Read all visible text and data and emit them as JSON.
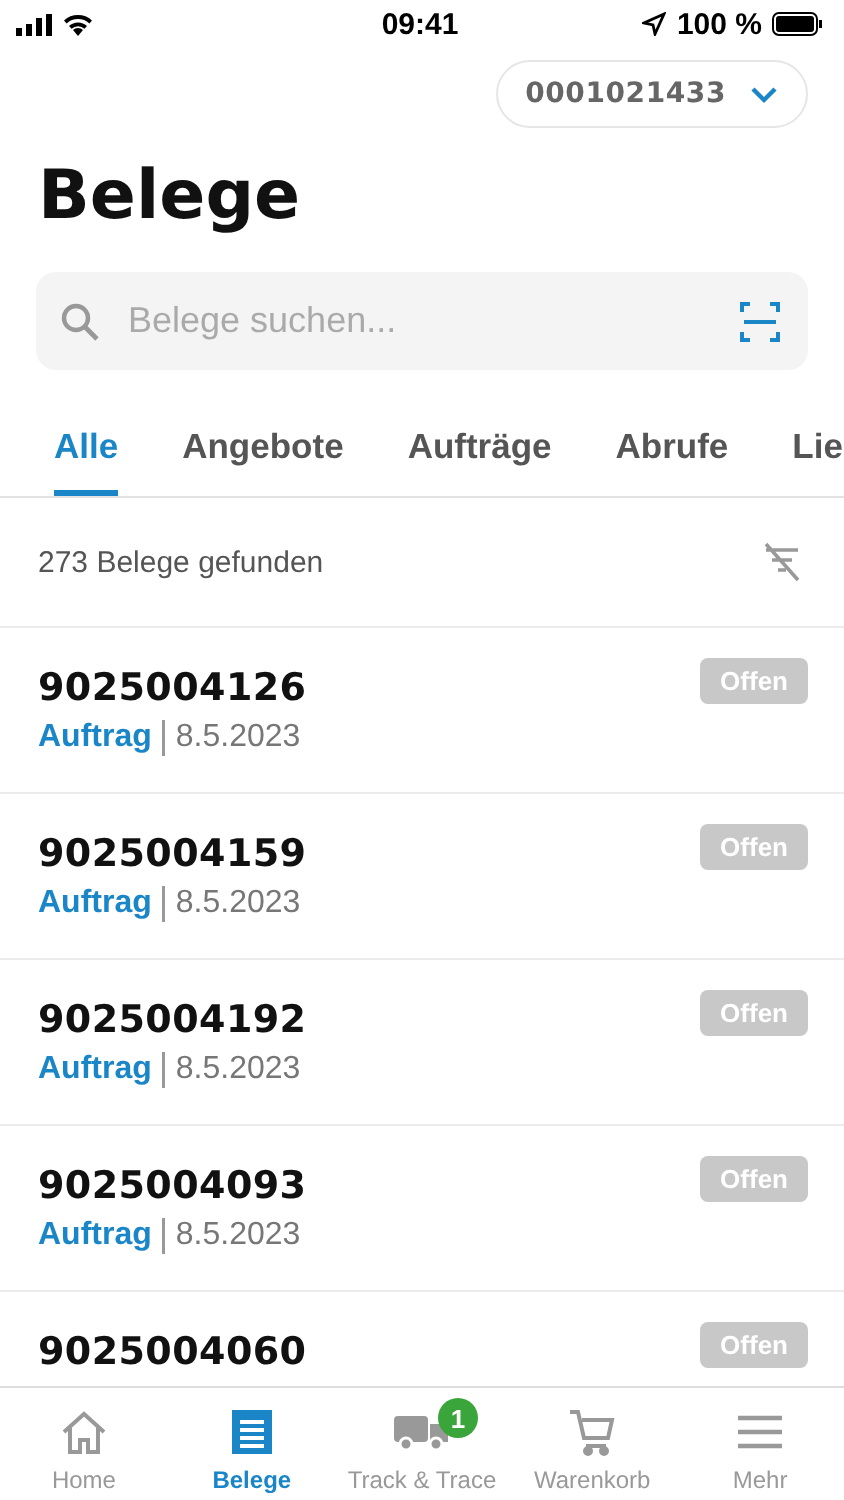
{
  "status_bar": {
    "time": "09:41",
    "battery": "100 %"
  },
  "account": {
    "number": "0001021433"
  },
  "title": "Belege",
  "search": {
    "placeholder": "Belege suchen..."
  },
  "tabs": [
    {
      "label": "Alle",
      "selected": true
    },
    {
      "label": "Angebote",
      "selected": false
    },
    {
      "label": "Aufträge",
      "selected": false
    },
    {
      "label": "Abrufe",
      "selected": false
    },
    {
      "label": "Lie",
      "selected": false
    }
  ],
  "result_count": "273 Belege gefunden",
  "documents": [
    {
      "number": "9025004126",
      "type": "Auftrag",
      "date": "8.5.2023",
      "status": "Offen"
    },
    {
      "number": "9025004159",
      "type": "Auftrag",
      "date": "8.5.2023",
      "status": "Offen"
    },
    {
      "number": "9025004192",
      "type": "Auftrag",
      "date": "8.5.2023",
      "status": "Offen"
    },
    {
      "number": "9025004093",
      "type": "Auftrag",
      "date": "8.5.2023",
      "status": "Offen"
    },
    {
      "number": "9025004060",
      "status": "Offen"
    }
  ],
  "nav": [
    {
      "kind": "home",
      "label": "Home",
      "selected": false
    },
    {
      "kind": "documents",
      "label": "Belege",
      "selected": true
    },
    {
      "kind": "truck",
      "label": "Track & Trace",
      "selected": false,
      "badge": "1"
    },
    {
      "kind": "cart",
      "label": "Warenkorb",
      "selected": false
    },
    {
      "kind": "menu",
      "label": "Mehr",
      "selected": false
    }
  ]
}
